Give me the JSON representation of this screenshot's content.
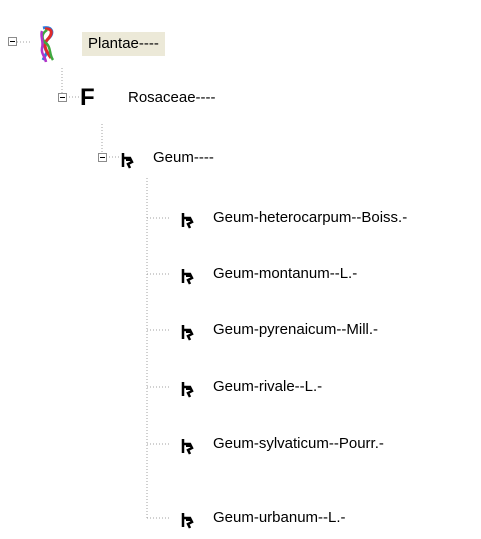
{
  "tree": {
    "root": {
      "label": "Plantae----",
      "icon": "kingdom-ribbon-icon",
      "expanded": true,
      "selected": true
    },
    "family": {
      "label": "Rosaceae----",
      "icon": "family-f-icon",
      "icon_glyph": "F",
      "expanded": true
    },
    "genus": {
      "label": "Geum----",
      "icon": "genus-icon",
      "expanded": true
    },
    "species": [
      {
        "label": "Geum-heterocarpum--Boiss.-",
        "icon": "species-icon"
      },
      {
        "label": "Geum-montanum--L.-",
        "icon": "species-icon"
      },
      {
        "label": "Geum-pyrenaicum--Mill.-",
        "icon": "species-icon"
      },
      {
        "label": "Geum-rivale--L.-",
        "icon": "species-icon"
      },
      {
        "label": "Geum-sylvaticum--Pourr.-",
        "icon": "species-icon"
      },
      {
        "label": "Geum-urbanum--L.-",
        "icon": "species-icon"
      }
    ]
  },
  "colors": {
    "selection_background": "#ece9d8",
    "tree_lines": "#a0a0a0",
    "expander_border": "#8c8c8c"
  }
}
